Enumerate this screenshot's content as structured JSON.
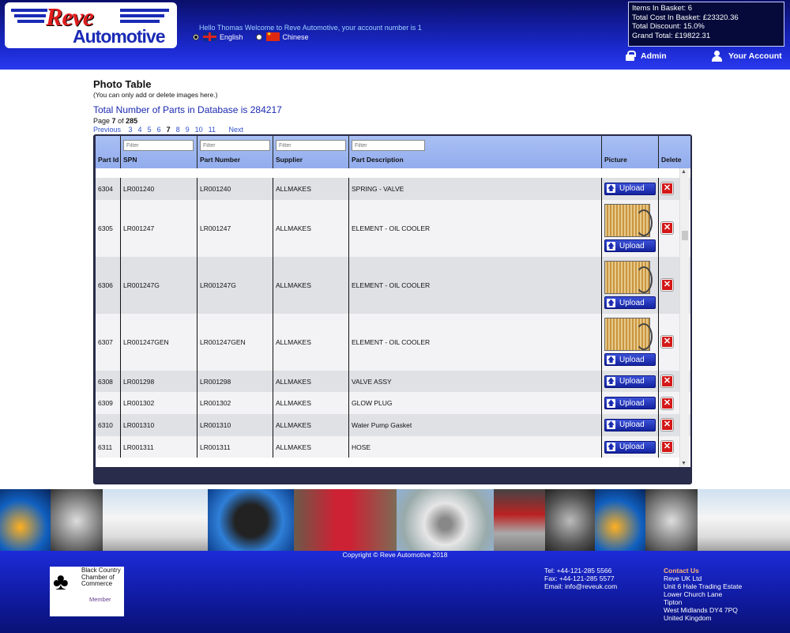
{
  "header": {
    "logo_line1": "Reve",
    "logo_line2": "Automotive",
    "welcome": "Hello Thomas Welcome to Reve Automotive, your account number is 1",
    "languages": [
      {
        "label": "English",
        "selected": true,
        "flag": "uk-flag-icon"
      },
      {
        "label": "Chinese",
        "selected": false,
        "flag": "china-flag-icon"
      }
    ],
    "basket": {
      "items": "Items In Basket: 6",
      "total_cost": "Total Cost In Basket: £23320.36",
      "discount": "Total Discount: 15.0%",
      "grand_total": "Grand Total: £19822.31"
    },
    "admin_label": "Admin",
    "account_label": "Your Account"
  },
  "main": {
    "title": "Photo Table",
    "note": "(You can only add or delete images here.)",
    "total_parts": "Total Number of Parts in Database is 284217",
    "page_label": "Page",
    "page_current": "7",
    "page_of": "of",
    "page_total": "285",
    "pager": {
      "previous": "Previous",
      "pages": [
        "3",
        "4",
        "5",
        "6",
        "7",
        "8",
        "9",
        "10",
        "11"
      ],
      "current": "7",
      "next": "Next"
    }
  },
  "table": {
    "columns": {
      "part_id": "Part Id",
      "spn": "SPN",
      "part_number": "Part Number",
      "supplier": "Supplier",
      "description": "Part Description",
      "picture": "Picture",
      "delete": "Delete"
    },
    "filter_placeholder": "Filter",
    "upload_label": "Upload",
    "delete_glyph": "✕",
    "rows": [
      {
        "id": "6304",
        "spn": "LR001240",
        "part_number": "LR001240",
        "supplier": "ALLMAKES",
        "description": "SPRING - VALVE",
        "has_image": false
      },
      {
        "id": "6305",
        "spn": "LR001247",
        "part_number": "LR001247",
        "supplier": "ALLMAKES",
        "description": "ELEMENT - OIL COOLER",
        "has_image": true
      },
      {
        "id": "6306",
        "spn": "LR001247G",
        "part_number": "LR001247G",
        "supplier": "ALLMAKES",
        "description": "ELEMENT - OIL COOLER",
        "has_image": true
      },
      {
        "id": "6307",
        "spn": "LR001247GEN",
        "part_number": "LR001247GEN",
        "supplier": "ALLMAKES",
        "description": "ELEMENT - OIL COOLER",
        "has_image": true
      },
      {
        "id": "6308",
        "spn": "LR001298",
        "part_number": "LR001298",
        "supplier": "ALLMAKES",
        "description": "VALVE ASSY",
        "has_image": false
      },
      {
        "id": "6309",
        "spn": "LR001302",
        "part_number": "LR001302",
        "supplier": "ALLMAKES",
        "description": "GLOW PLUG",
        "has_image": false
      },
      {
        "id": "6310",
        "spn": "LR001310",
        "part_number": "LR001310",
        "supplier": "ALLMAKES",
        "description": "Water Pump Gasket",
        "has_image": false
      },
      {
        "id": "6311",
        "spn": "LR001311",
        "part_number": "LR001311",
        "supplier": "ALLMAKES",
        "description": "HOSE",
        "has_image": false
      }
    ]
  },
  "footer": {
    "copyright": "Copyright © Reve Automotive 2018",
    "chamber_line1": "Black Country",
    "chamber_line2": "Chamber of",
    "chamber_line3": "Commerce",
    "chamber_member": "Member",
    "tel": "Tel: +44-121-285 5566",
    "fax": "Fax: +44-121-285 5577",
    "email": "Email: info@reveuk.com",
    "contact_heading": "Contact Us",
    "address": [
      "Reve UK Ltd",
      "Unit 6 Hale Trading Estate",
      "Lower Church Lane",
      "Tipton",
      "West Midlands DY4 7PQ",
      "United Kingdom"
    ]
  },
  "colors": {
    "header_blue": "#1b2ad0",
    "link_blue": "#2f4fcc",
    "contact_orange": "#ffb37a",
    "delete_red": "#d41818"
  }
}
